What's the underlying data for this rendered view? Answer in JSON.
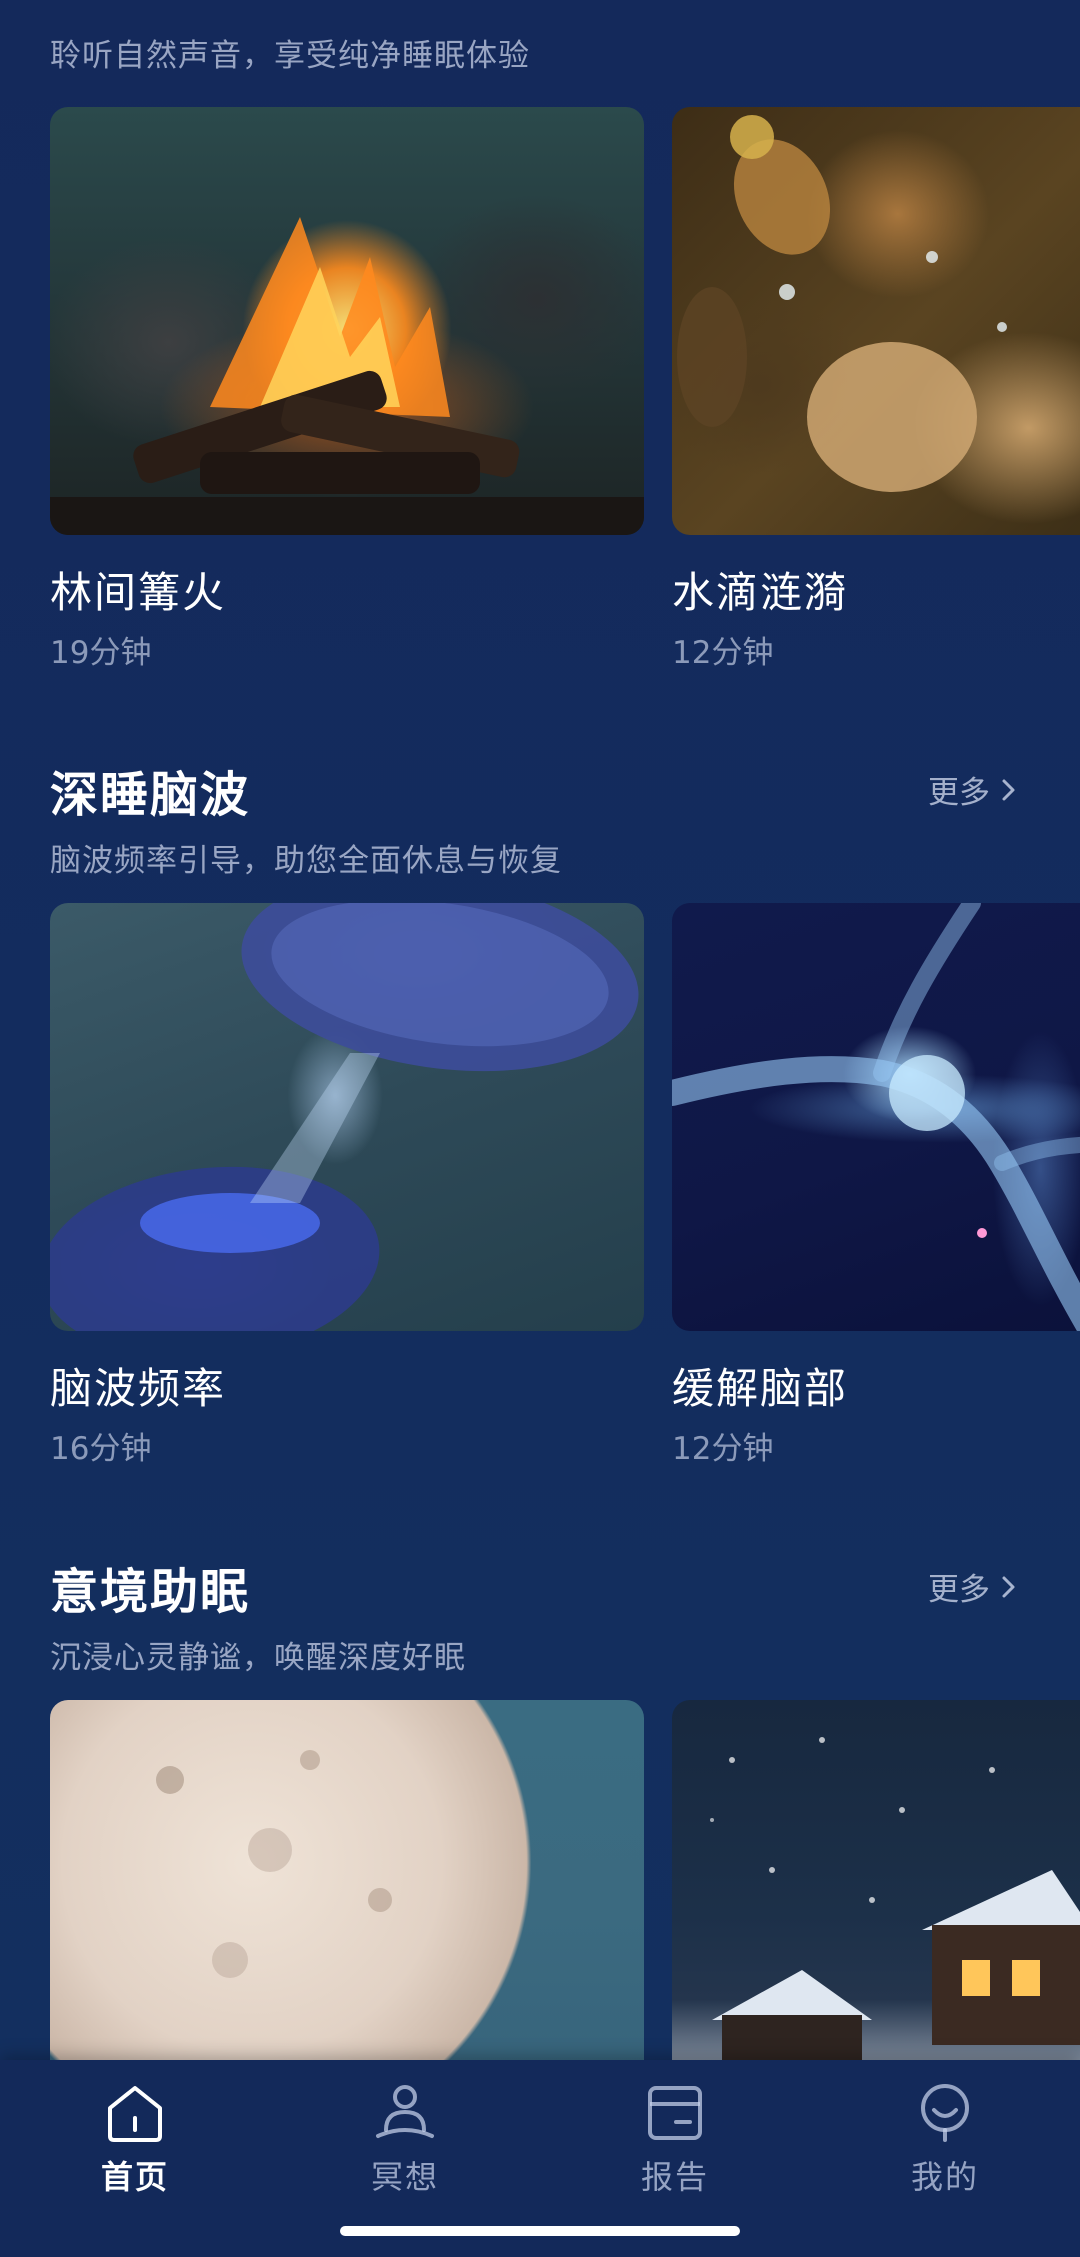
{
  "top_section": {
    "subtitle": "聆听自然声音，享受纯净睡眠体验",
    "cards": [
      {
        "title": "林间篝火",
        "duration": "19分钟"
      },
      {
        "title": "水滴涟漪",
        "duration": "12分钟"
      }
    ]
  },
  "brainwave_section": {
    "title": "深睡脑波",
    "subtitle": "脑波频率引导，助您全面休息与恢复",
    "more_label": "更多",
    "cards": [
      {
        "title": "脑波频率",
        "duration": "16分钟"
      },
      {
        "title": "缓解脑部",
        "duration": "12分钟"
      }
    ]
  },
  "imagery_section": {
    "title": "意境助眠",
    "subtitle": "沉浸心灵静谧，唤醒深度好眠",
    "more_label": "更多"
  },
  "bottom_nav": {
    "items": [
      {
        "label": "首页",
        "icon": "home-icon",
        "active": true
      },
      {
        "label": "冥想",
        "icon": "meditation-icon",
        "active": false
      },
      {
        "label": "报告",
        "icon": "report-icon",
        "active": false
      },
      {
        "label": "我的",
        "icon": "profile-icon",
        "active": false
      }
    ]
  },
  "colors": {
    "background": "#132c5e",
    "nav_background": "#13295a",
    "text_primary": "#ffffff",
    "text_secondary": "#cdd6eb"
  }
}
